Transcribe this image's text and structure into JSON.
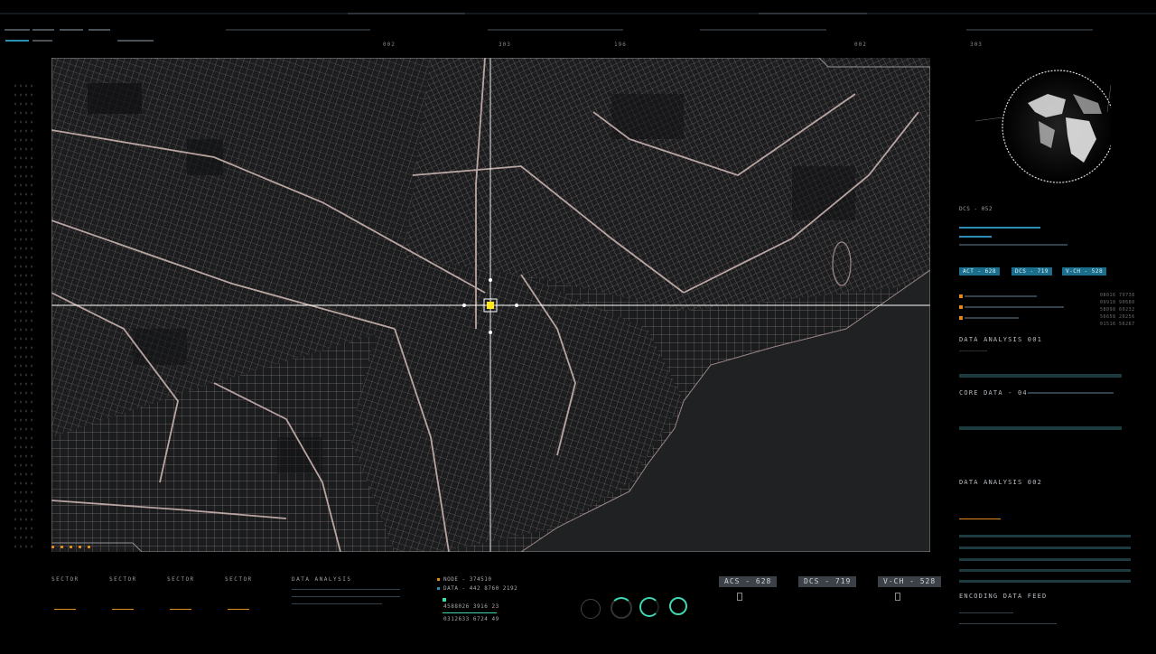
{
  "top_bar": {
    "numbers": [
      "002",
      "303",
      "196",
      "002",
      "303"
    ]
  },
  "map": {
    "name": "city-street-map",
    "marker_color": "#ffe81a",
    "crosshair_color": "#ffffff",
    "street_color": "#a8908e",
    "background": "#1b1c1e",
    "water": "#1f2022"
  },
  "right_panel": {
    "dcs_label": "DCS - 052",
    "tags": [
      "ACT - 628",
      "DCS - 719",
      "V-CH - 528"
    ],
    "data_analysis_1": "DATA ANALYSIS 001",
    "core_data": "CORE DATA - 04",
    "data_analysis_2": "DATA ANALYSIS 002",
    "encoding": "ENCODING DATA FEED",
    "side_numbers": [
      "08016 79738",
      "09918 90680",
      "58098 60232",
      "56658 20256",
      "01516 56267"
    ]
  },
  "bottom": {
    "sectors": [
      "SECTOR",
      "SECTOR",
      "SECTOR",
      "SECTOR"
    ],
    "data_analysis": "DATA ANALYSIS",
    "node": "NODE - 374510",
    "data": "DATA - 442 8760 2192",
    "row1": "4588026   3916   23",
    "row2": "0312633   6724   49",
    "badges": [
      "ACS - 628",
      "DCS - 719",
      "V-CH - 528"
    ]
  },
  "colors": {
    "accent_blue": "#2b8fb3",
    "accent_orange": "#e38a1c",
    "accent_green": "#3fd6b0"
  }
}
